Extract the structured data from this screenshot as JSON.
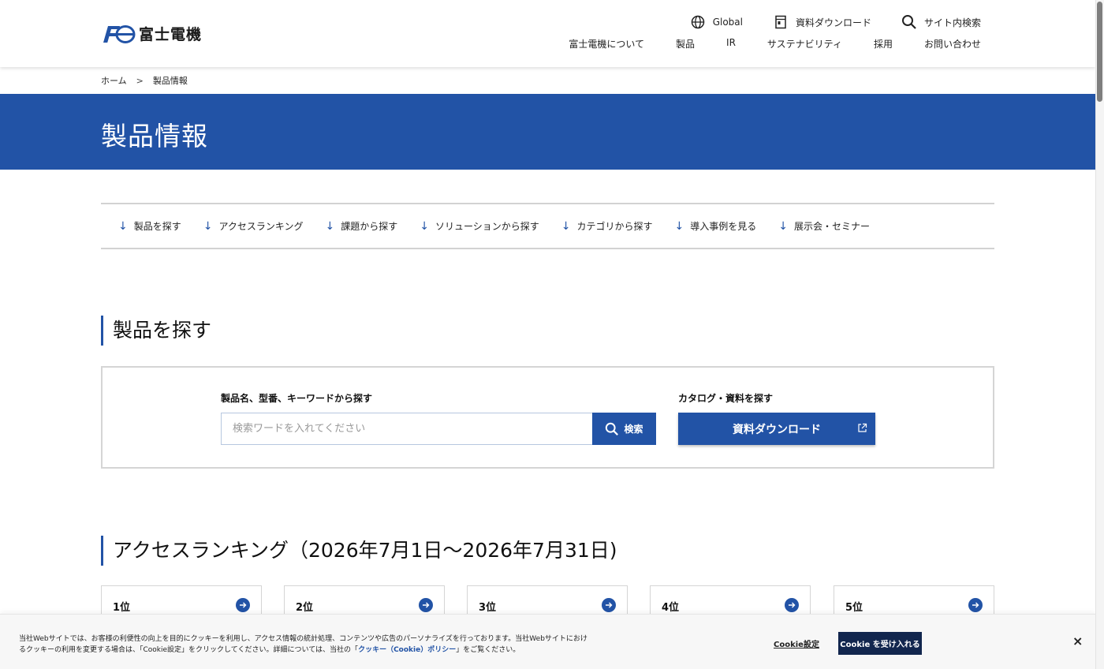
{
  "header": {
    "logo_text": "富士電機",
    "utility_nav": [
      {
        "label": "Global",
        "icon": "globe-icon"
      },
      {
        "label": "資料ダウンロード",
        "icon": "document-icon"
      },
      {
        "label": "サイト内検索",
        "icon": "search-icon"
      }
    ],
    "main_nav": [
      "富士電機について",
      "製品",
      "IR",
      "サステナビリティ",
      "採用",
      "お問い合わせ"
    ]
  },
  "breadcrumb": {
    "home": "ホーム",
    "separator": ">",
    "current": "製品情報"
  },
  "hero": {
    "title": "製品情報"
  },
  "anchor_nav": [
    "製品を探す",
    "アクセスランキング",
    "課題から探す",
    "ソリューションから探す",
    "カテゴリから探す",
    "導入事例を見る",
    "展示会・セミナー"
  ],
  "search_section": {
    "heading": "製品を探す",
    "keyword_label": "製品名、型番、キーワードから探す",
    "input_placeholder": "検索ワードを入れてください",
    "input_value": "",
    "search_button": "検索",
    "catalog_label": "カタログ・資料を探す",
    "download_button": "資料ダウンロード"
  },
  "ranking_section": {
    "heading": "アクセスランキング（2026年7月1日〜2026年7月31日)",
    "ranks": [
      "1位",
      "2位",
      "3位",
      "4位",
      "5位"
    ]
  },
  "cookie_banner": {
    "text_line1": "当社Webサイトでは、お客様の利便性の向上を目的にクッキーを利用し、アクセス情報の統計処理、コンテンツや広告のパーソナライズを行っております。当社Webサイトにおけ",
    "text_line2_pre": "るクッキーの利用を変更する場合は、「Cookie設定」をクリックしてください。詳細については、当社の「",
    "text_link": "クッキー（Cookie）ポリシー",
    "text_line2_post": "」をご覧ください。",
    "settings_label": "Cookie設定",
    "accept_label": "Cookie を受け入れる",
    "close_label": "×"
  },
  "colors": {
    "brand_blue": "#2253a6",
    "accept_navy": "#12264e"
  }
}
